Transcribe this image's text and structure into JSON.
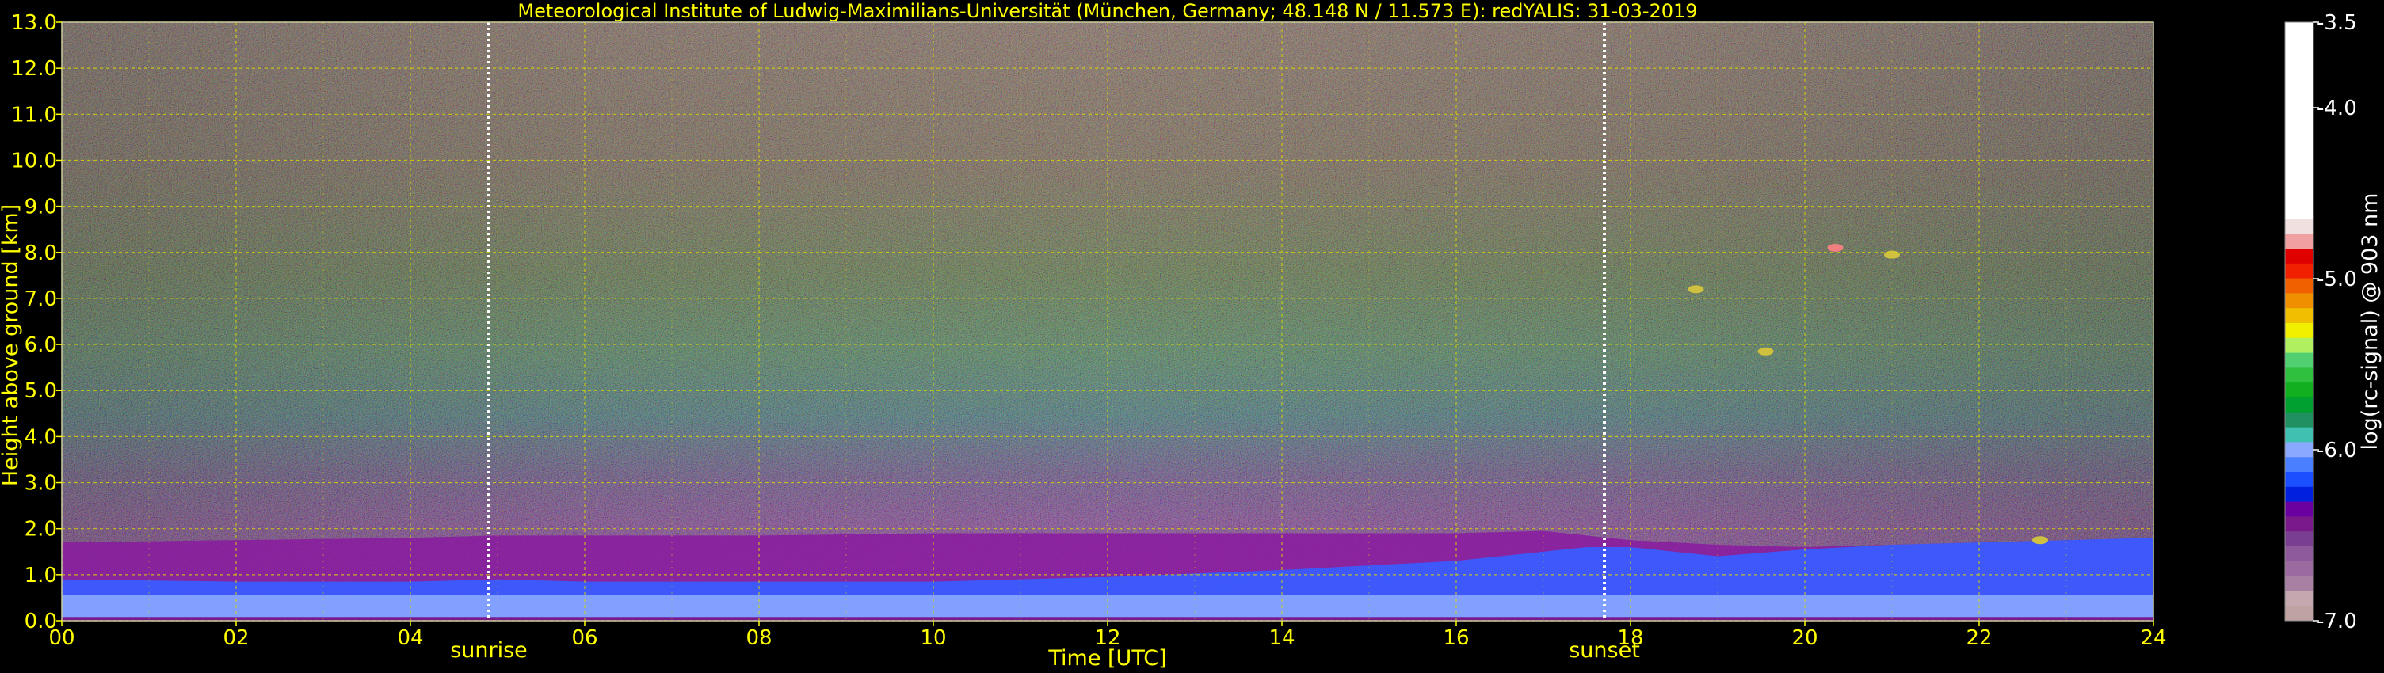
{
  "chart_data": {
    "type": "heatmap",
    "title": "Meteorological Institute of Ludwig-Maximilians-Universität (München, Germany; 48.148 N / 11.573 E):    redYALIS: 31-03-2019",
    "xlabel": "Time [UTC]",
    "ylabel": "Height above ground [km]",
    "xlim": [
      0,
      24
    ],
    "ylim": [
      0,
      13
    ],
    "x_ticks": [
      "00",
      "02",
      "04",
      "06",
      "08",
      "10",
      "12",
      "14",
      "16",
      "18",
      "20",
      "22",
      "24"
    ],
    "x_tick_values": [
      0,
      2,
      4,
      6,
      8,
      10,
      12,
      14,
      16,
      18,
      20,
      22,
      24
    ],
    "y_ticks": [
      "0.0",
      "1.0",
      "2.0",
      "3.0",
      "4.0",
      "5.0",
      "6.0",
      "7.0",
      "8.0",
      "9.0",
      "10.0",
      "11.0",
      "12.0",
      "13.0"
    ],
    "y_tick_values": [
      0,
      1,
      2,
      3,
      4,
      5,
      6,
      7,
      8,
      9,
      10,
      11,
      12,
      13
    ],
    "grid": true,
    "events": [
      {
        "label": "sunrise",
        "time": 4.9
      },
      {
        "label": "sunset",
        "time": 17.7
      }
    ],
    "colorbar": {
      "label": "log(rc-signal) @ 903 nm",
      "range": [
        -7.0,
        -3.5
      ],
      "ticks": [
        "-3.5",
        "-4.0",
        "-5.0",
        "-6.0",
        "-7.0"
      ],
      "tick_values": [
        -3.5,
        -4.0,
        -5.0,
        -6.0,
        -7.0
      ],
      "colors": [
        "#bfa3a3",
        "#c4a8b0",
        "#a880a4",
        "#9a6aa0",
        "#8e5a9c",
        "#7a3e90",
        "#7a1a8a",
        "#6a00a0",
        "#0020e0",
        "#1a50ff",
        "#4a80ff",
        "#8aa8ff",
        "#40c0b0",
        "#209060",
        "#00a030",
        "#10b020",
        "#30c040",
        "#50d070",
        "#b0f060",
        "#f0f000",
        "#f0c000",
        "#f09000",
        "#f06000",
        "#f02000",
        "#e00000",
        "#f0a0a0",
        "#f0e0e0",
        "#ffffff"
      ]
    },
    "boundary_layer_top_km": {
      "x": [
        0,
        2,
        4,
        5,
        6,
        8,
        10,
        12,
        14,
        16,
        17,
        18,
        19,
        20,
        21,
        22,
        23,
        24
      ],
      "y": [
        1.7,
        1.75,
        1.8,
        1.85,
        1.85,
        1.85,
        1.9,
        1.9,
        1.9,
        1.9,
        1.95,
        1.75,
        1.65,
        1.6,
        1.65,
        1.7,
        1.75,
        1.8
      ]
    },
    "aerosol_layer_top_km": {
      "x": [
        0,
        2,
        4,
        5,
        6,
        8,
        10,
        12,
        14,
        16,
        17.5,
        18,
        19,
        20,
        21,
        22,
        23,
        24
      ],
      "y": [
        0.9,
        0.85,
        0.85,
        0.9,
        0.85,
        0.85,
        0.85,
        0.95,
        1.1,
        1.3,
        1.6,
        1.6,
        1.4,
        1.55,
        1.65,
        1.7,
        1.75,
        1.8
      ]
    },
    "cloud_features": [
      {
        "time": 20.35,
        "height_km": 8.1
      },
      {
        "time": 21.0,
        "height_km": 7.95
      },
      {
        "time": 19.55,
        "height_km": 5.85
      },
      {
        "time": 18.75,
        "height_km": 7.2
      },
      {
        "time": 22.7,
        "height_km": 1.75
      }
    ]
  }
}
